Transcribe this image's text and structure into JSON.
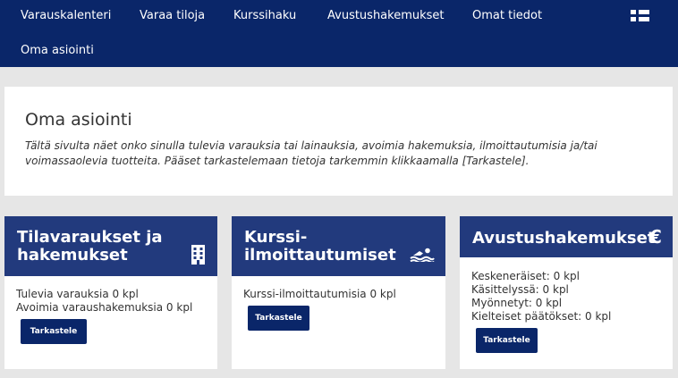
{
  "nav": {
    "items": [
      "Varauskalenteri",
      "Varaa tiloja",
      "Kurssihaku",
      "Avustushakemukset",
      "Omat tiedot",
      "Oma asiointi"
    ]
  },
  "intro": {
    "title": "Oma asiointi",
    "text": "Tältä sivulta näet onko sinulla tulevia varauksia tai lainauksia, avoimia hakemuksia, ilmoittautumisia ja/tai voimassaolevia tuotteita. Pääset tarkastelemaan tietoja tarkemmin klikkaamalla [Tarkastele]."
  },
  "cards": [
    {
      "title_line1": "Tilavaraukset ja",
      "title_line2": "hakemukset",
      "icon": "building-icon",
      "lines": [
        "Tulevia varauksia 0 kpl",
        "Avoimia varaushakemuksia 0 kpl"
      ],
      "button": "Tarkastele"
    },
    {
      "title_line1": "Kurssi-",
      "title_line2": "ilmoittautumiset",
      "icon": "swimmer-icon",
      "lines": [
        "Kurssi-ilmoittautumisia 0 kpl"
      ],
      "button": "Tarkastele"
    },
    {
      "title_line1": "Avustushakemukset",
      "icon": "euro-icon",
      "icon_text": "€",
      "lines": [
        "Keskeneräiset: 0 kpl",
        "Käsittelyssä: 0 kpl",
        "Myönnetyt: 0 kpl",
        "Kielteiset päätökset: 0 kpl"
      ],
      "button": "Tarkastele"
    }
  ],
  "colors": {
    "nav_bg": "#0a2669",
    "card_header_bg": "#223a7d",
    "button_bg": "#0a2669",
    "page_bg": "#e6e6e6"
  }
}
